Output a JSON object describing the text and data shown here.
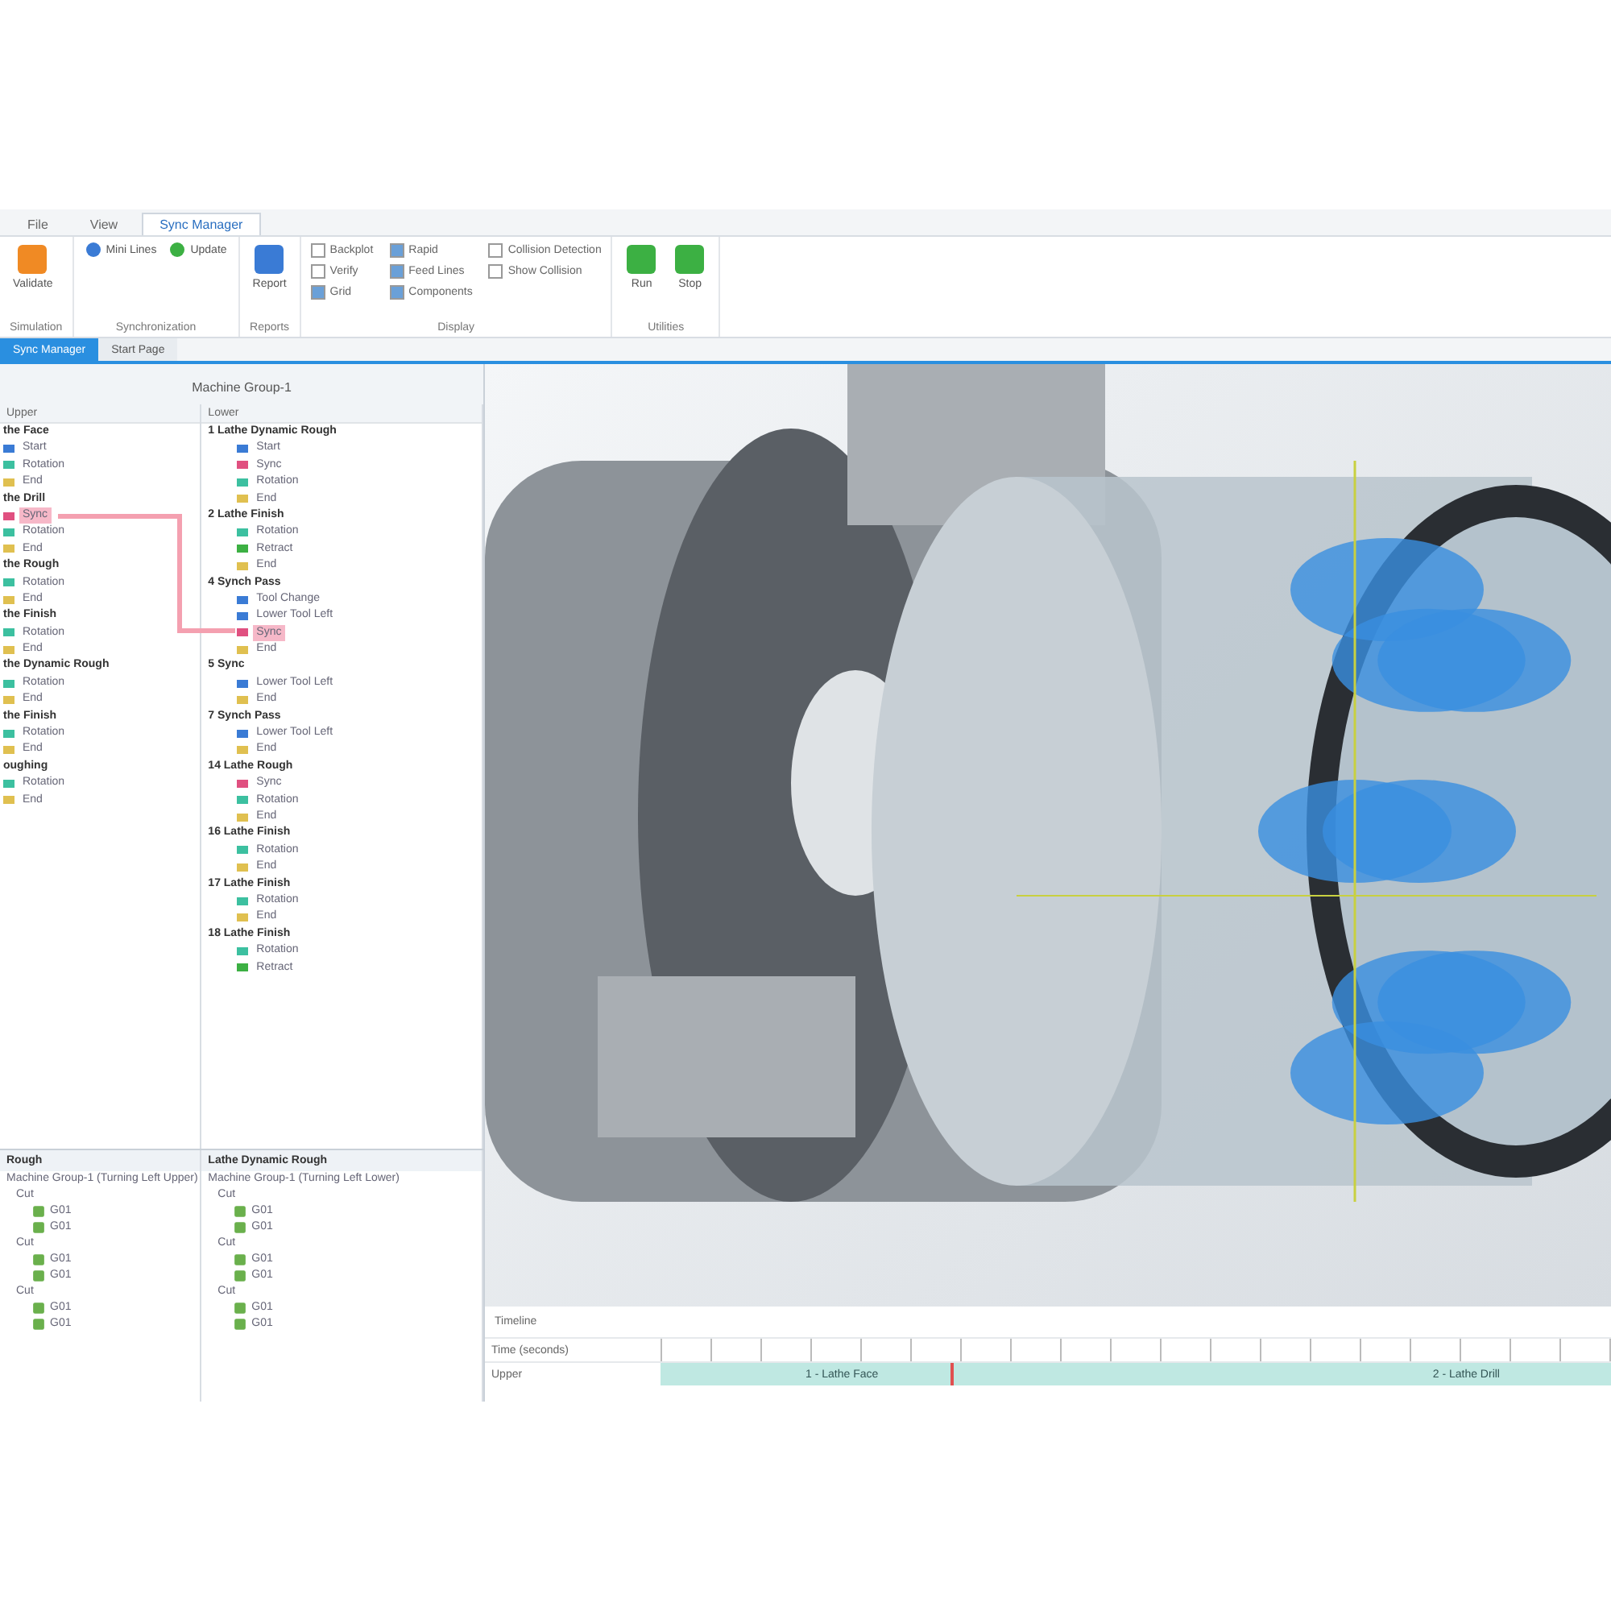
{
  "ribbon": {
    "tabs": [
      {
        "label": "File",
        "selected": false
      },
      {
        "label": "View",
        "selected": false
      },
      {
        "label": "Sync Manager",
        "selected": true
      }
    ],
    "groups": [
      {
        "label": "Simulation",
        "items": [
          {
            "kind": "large",
            "label": "Validate",
            "color": "#f08a24"
          }
        ]
      },
      {
        "label": "Synchronization",
        "items": [
          {
            "kind": "small",
            "label": "Mini Lines",
            "color": "#3a7bd5"
          },
          {
            "kind": "small",
            "label": "Update",
            "color": "#3cb043"
          }
        ]
      },
      {
        "label": "Reports",
        "items": [
          {
            "kind": "large",
            "label": "Report",
            "color": "#3a7bd5"
          }
        ]
      },
      {
        "label": "Display",
        "items": [
          {
            "kind": "check",
            "label": "Backplot",
            "checked": false
          },
          {
            "kind": "check",
            "label": "Verify",
            "checked": false
          },
          {
            "kind": "check",
            "label": "Grid",
            "checked": true
          },
          {
            "kind": "check",
            "label": "Rapid",
            "checked": true
          },
          {
            "kind": "check",
            "label": "Feed Lines",
            "checked": true
          },
          {
            "kind": "check",
            "label": "Components",
            "checked": true
          },
          {
            "kind": "check",
            "label": "Collision Detection",
            "checked": false
          },
          {
            "kind": "check",
            "label": "Show Collision",
            "checked": false
          }
        ]
      },
      {
        "label": "Utilities",
        "items": [
          {
            "kind": "large",
            "label": "Run",
            "color": "#3cb043"
          },
          {
            "kind": "large",
            "label": "Stop",
            "color": "#3cb043"
          }
        ]
      }
    ]
  },
  "doc_tabs": [
    {
      "label": "Sync Manager",
      "selected": true
    },
    {
      "label": "Start Page",
      "selected": false
    }
  ],
  "panel": {
    "title": "Machine Group-1",
    "columns": [
      {
        "header": "Upper",
        "items": [
          {
            "kind": "op",
            "label": "the Face"
          },
          {
            "kind": "step",
            "label": "Start",
            "color": "#3a7bd5",
            "selected": false
          },
          {
            "kind": "step",
            "label": "Rotation",
            "color": "#3cc0a0",
            "selected": false
          },
          {
            "kind": "step",
            "label": "End",
            "color": "#e0c050",
            "selected": false
          },
          {
            "kind": "op",
            "label": "the Drill"
          },
          {
            "kind": "step",
            "label": "Sync",
            "color": "#e05080",
            "selected": true
          },
          {
            "kind": "step",
            "label": "Rotation",
            "color": "#3cc0a0",
            "selected": false
          },
          {
            "kind": "step",
            "label": "End",
            "color": "#e0c050",
            "selected": false
          },
          {
            "kind": "op",
            "label": "the Rough"
          },
          {
            "kind": "step",
            "label": "Rotation",
            "color": "#3cc0a0",
            "selected": false
          },
          {
            "kind": "step",
            "label": "End",
            "color": "#e0c050",
            "selected": false
          },
          {
            "kind": "op",
            "label": "the Finish"
          },
          {
            "kind": "step",
            "label": "Rotation",
            "color": "#3cc0a0",
            "selected": false
          },
          {
            "kind": "step",
            "label": "End",
            "color": "#e0c050",
            "selected": false
          },
          {
            "kind": "op",
            "label": "the Dynamic Rough"
          },
          {
            "kind": "step",
            "label": "Rotation",
            "color": "#3cc0a0",
            "selected": false
          },
          {
            "kind": "step",
            "label": "End",
            "color": "#e0c050",
            "selected": false
          },
          {
            "kind": "op",
            "label": "the Finish"
          },
          {
            "kind": "step",
            "label": "Rotation",
            "color": "#3cc0a0",
            "selected": false
          },
          {
            "kind": "step",
            "label": "End",
            "color": "#e0c050",
            "selected": false
          },
          {
            "kind": "op",
            "label": "oughing"
          },
          {
            "kind": "step",
            "label": "Rotation",
            "color": "#3cc0a0",
            "selected": false
          },
          {
            "kind": "step",
            "label": "End",
            "color": "#e0c050",
            "selected": false
          }
        ]
      },
      {
        "header": "Lower",
        "items": [
          {
            "kind": "op",
            "label": "1  Lathe Dynamic Rough"
          },
          {
            "kind": "step",
            "label": "Start",
            "color": "#3a7bd5",
            "selected": false
          },
          {
            "kind": "step",
            "label": "Sync",
            "color": "#e05080",
            "selected": false
          },
          {
            "kind": "step",
            "label": "Rotation",
            "color": "#3cc0a0",
            "selected": false
          },
          {
            "kind": "step",
            "label": "End",
            "color": "#e0c050",
            "selected": false
          },
          {
            "kind": "op",
            "label": "2  Lathe Finish"
          },
          {
            "kind": "step",
            "label": "Rotation",
            "color": "#3cc0a0",
            "selected": false
          },
          {
            "kind": "step",
            "label": "Retract",
            "color": "#3cb043",
            "selected": false
          },
          {
            "kind": "step",
            "label": "End",
            "color": "#e0c050",
            "selected": false
          },
          {
            "kind": "op",
            "label": "4  Synch Pass"
          },
          {
            "kind": "step",
            "label": "Tool Change",
            "color": "#3a7bd5",
            "selected": false
          },
          {
            "kind": "step",
            "label": "Lower Tool Left",
            "color": "#3a7bd5",
            "selected": false
          },
          {
            "kind": "step",
            "label": "Sync",
            "color": "#e05080",
            "selected": true
          },
          {
            "kind": "step",
            "label": "End",
            "color": "#e0c050",
            "selected": false
          },
          {
            "kind": "op",
            "label": "5  Sync"
          },
          {
            "kind": "step",
            "label": "Lower Tool Left",
            "color": "#3a7bd5",
            "selected": false
          },
          {
            "kind": "step",
            "label": "End",
            "color": "#e0c050",
            "selected": false
          },
          {
            "kind": "op",
            "label": "7  Synch Pass"
          },
          {
            "kind": "step",
            "label": "Lower Tool Left",
            "color": "#3a7bd5",
            "selected": false
          },
          {
            "kind": "step",
            "label": "End",
            "color": "#e0c050",
            "selected": false
          },
          {
            "kind": "op",
            "label": "14  Lathe Rough"
          },
          {
            "kind": "step",
            "label": "Sync",
            "color": "#e05080",
            "selected": false
          },
          {
            "kind": "step",
            "label": "Rotation",
            "color": "#3cc0a0",
            "selected": false
          },
          {
            "kind": "step",
            "label": "End",
            "color": "#e0c050",
            "selected": false
          },
          {
            "kind": "op",
            "label": "16  Lathe Finish"
          },
          {
            "kind": "step",
            "label": "Rotation",
            "color": "#3cc0a0",
            "selected": false
          },
          {
            "kind": "step",
            "label": "End",
            "color": "#e0c050",
            "selected": false
          },
          {
            "kind": "op",
            "label": "17  Lathe Finish"
          },
          {
            "kind": "step",
            "label": "Rotation",
            "color": "#3cc0a0",
            "selected": false
          },
          {
            "kind": "step",
            "label": "End",
            "color": "#e0c050",
            "selected": false
          },
          {
            "kind": "op",
            "label": "18  Lathe Finish"
          },
          {
            "kind": "step",
            "label": "Rotation",
            "color": "#3cc0a0",
            "selected": false
          },
          {
            "kind": "step",
            "label": "Retract",
            "color": "#3cb043",
            "selected": false
          }
        ]
      }
    ]
  },
  "detail": [
    {
      "title": "Rough",
      "group": "Machine Group-1 (Turning Left Upper)",
      "nodes": [
        {
          "label": "Cut",
          "children": [
            "G01",
            "G01"
          ]
        },
        {
          "label": "Cut",
          "children": [
            "G01",
            "G01"
          ]
        },
        {
          "label": "Cut",
          "children": [
            "G01",
            "G01"
          ]
        }
      ]
    },
    {
      "title": "Lathe Dynamic Rough",
      "group": "Machine Group-1 (Turning Left Lower)",
      "nodes": [
        {
          "label": "Cut",
          "children": [
            "G01",
            "G01"
          ]
        },
        {
          "label": "Cut",
          "children": [
            "G01",
            "G01"
          ]
        },
        {
          "label": "Cut",
          "children": [
            "G01",
            "G01"
          ]
        }
      ]
    }
  ],
  "timeline": {
    "title": "Timeline",
    "row_header": "Time (seconds)",
    "lane": "Upper",
    "bars": [
      {
        "label": "1 - Lathe Face"
      },
      {
        "label": "2 - Lathe Drill"
      }
    ]
  }
}
